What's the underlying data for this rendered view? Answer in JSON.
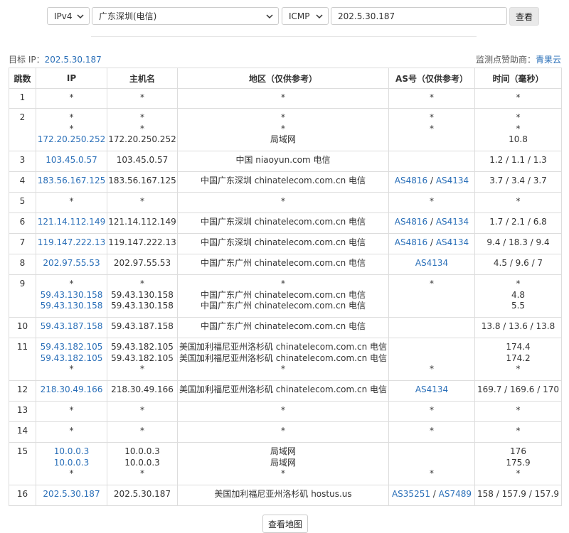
{
  "toolbar": {
    "ip_version": "IPv4",
    "node": "广东深圳(电信)",
    "protocol": "ICMP",
    "target_value": "202.5.30.187",
    "query_label": "查看"
  },
  "target_label": "目标 IP：",
  "target_ip": "202.5.30.187",
  "sponsor_label": "监测点赞助商：",
  "sponsor_name": "青果云",
  "table": {
    "headers": [
      "跳数",
      "IP",
      "主机名",
      "地区（仅供参考）",
      "AS号（仅供参考）",
      "时间（毫秒）"
    ],
    "rows": [
      {
        "hop": "1",
        "ip": [
          "*"
        ],
        "host": [
          "*"
        ],
        "region": [
          "*"
        ],
        "asn": [
          [
            "*"
          ]
        ],
        "time": [
          "*"
        ]
      },
      {
        "hop": "2",
        "ip": [
          "*",
          "*",
          "172.20.250.252"
        ],
        "host": [
          "*",
          "*",
          "172.20.250.252"
        ],
        "region": [
          "*",
          "*",
          "局域网"
        ],
        "asn": [
          [
            "*"
          ],
          [
            "*"
          ],
          [
            ""
          ]
        ],
        "time": [
          "*",
          "*",
          "10.8"
        ]
      },
      {
        "hop": "3",
        "ip": [
          "103.45.0.57"
        ],
        "host": [
          "103.45.0.57"
        ],
        "region": [
          "中国 niaoyun.com 电信"
        ],
        "asn": [
          [
            ""
          ]
        ],
        "time": [
          "1.2 / 1.1 / 1.3"
        ]
      },
      {
        "hop": "4",
        "ip": [
          "183.56.167.125"
        ],
        "host": [
          "183.56.167.125"
        ],
        "region": [
          "中国广东深圳 chinatelecom.com.cn 电信"
        ],
        "asn": [
          [
            "AS4816",
            "AS4134"
          ]
        ],
        "time": [
          "3.7 / 3.4 / 3.7"
        ]
      },
      {
        "hop": "5",
        "ip": [
          "*"
        ],
        "host": [
          "*"
        ],
        "region": [
          "*"
        ],
        "asn": [
          [
            "*"
          ]
        ],
        "time": [
          "*"
        ]
      },
      {
        "hop": "6",
        "ip": [
          "121.14.112.149"
        ],
        "host": [
          "121.14.112.149"
        ],
        "region": [
          "中国广东深圳 chinatelecom.com.cn 电信"
        ],
        "asn": [
          [
            "AS4816",
            "AS4134"
          ]
        ],
        "time": [
          "1.7 / 2.1 / 6.8"
        ]
      },
      {
        "hop": "7",
        "ip": [
          "119.147.222.13"
        ],
        "host": [
          "119.147.222.13"
        ],
        "region": [
          "中国广东深圳 chinatelecom.com.cn 电信"
        ],
        "asn": [
          [
            "AS4816",
            "AS4134"
          ]
        ],
        "time": [
          "9.4 / 18.3 / 9.4"
        ]
      },
      {
        "hop": "8",
        "ip": [
          "202.97.55.53"
        ],
        "host": [
          "202.97.55.53"
        ],
        "region": [
          "中国广东广州 chinatelecom.com.cn 电信"
        ],
        "asn": [
          [
            "AS4134"
          ]
        ],
        "time": [
          "4.5 / 9.6 / 7"
        ]
      },
      {
        "hop": "9",
        "ip": [
          "*",
          "59.43.130.158",
          "59.43.130.158"
        ],
        "host": [
          "*",
          "59.43.130.158",
          "59.43.130.158"
        ],
        "region": [
          "*",
          "中国广东广州 chinatelecom.com.cn 电信",
          "中国广东广州 chinatelecom.com.cn 电信"
        ],
        "asn": [
          [
            "*"
          ],
          [
            ""
          ],
          [
            ""
          ]
        ],
        "time": [
          "*",
          "4.8",
          "5.5"
        ]
      },
      {
        "hop": "10",
        "ip": [
          "59.43.187.158"
        ],
        "host": [
          "59.43.187.158"
        ],
        "region": [
          "中国广东广州 chinatelecom.com.cn 电信"
        ],
        "asn": [
          [
            ""
          ]
        ],
        "time": [
          "13.8 / 13.6 / 13.8"
        ]
      },
      {
        "hop": "11",
        "ip": [
          "59.43.182.105",
          "59.43.182.105",
          "*"
        ],
        "host": [
          "59.43.182.105",
          "59.43.182.105",
          "*"
        ],
        "region": [
          "美国加利福尼亚州洛杉矶 chinatelecom.com.cn 电信",
          "美国加利福尼亚州洛杉矶 chinatelecom.com.cn 电信",
          "*"
        ],
        "asn": [
          [
            ""
          ],
          [
            ""
          ],
          [
            "*"
          ]
        ],
        "time": [
          "174.4",
          "174.2",
          "*"
        ]
      },
      {
        "hop": "12",
        "ip": [
          "218.30.49.166"
        ],
        "host": [
          "218.30.49.166"
        ],
        "region": [
          "美国加利福尼亚州洛杉矶 chinatelecom.com.cn 电信"
        ],
        "asn": [
          [
            "AS4134"
          ]
        ],
        "time": [
          "169.7 / 169.6 / 170"
        ]
      },
      {
        "hop": "13",
        "ip": [
          "*"
        ],
        "host": [
          "*"
        ],
        "region": [
          "*"
        ],
        "asn": [
          [
            "*"
          ]
        ],
        "time": [
          "*"
        ]
      },
      {
        "hop": "14",
        "ip": [
          "*"
        ],
        "host": [
          "*"
        ],
        "region": [
          "*"
        ],
        "asn": [
          [
            "*"
          ]
        ],
        "time": [
          "*"
        ]
      },
      {
        "hop": "15",
        "ip": [
          "10.0.0.3",
          "10.0.0.3",
          "*"
        ],
        "host": [
          "10.0.0.3",
          "10.0.0.3",
          "*"
        ],
        "region": [
          "局域网",
          "局域网",
          "*"
        ],
        "asn": [
          [
            ""
          ],
          [
            ""
          ],
          [
            "*"
          ]
        ],
        "time": [
          "176",
          "175.9",
          "*"
        ]
      },
      {
        "hop": "16",
        "ip": [
          "202.5.30.187"
        ],
        "host": [
          "202.5.30.187"
        ],
        "region": [
          "美国加利福尼亚州洛杉矶 hostus.us"
        ],
        "asn": [
          [
            "AS35251",
            "AS7489"
          ]
        ],
        "time": [
          "158 / 157.9 / 157.9"
        ]
      }
    ]
  },
  "map_button_label": "查看地图",
  "colors": {
    "link": "#2a6fb8",
    "border": "#dddddd",
    "button_bg": "#e9e9e9"
  }
}
